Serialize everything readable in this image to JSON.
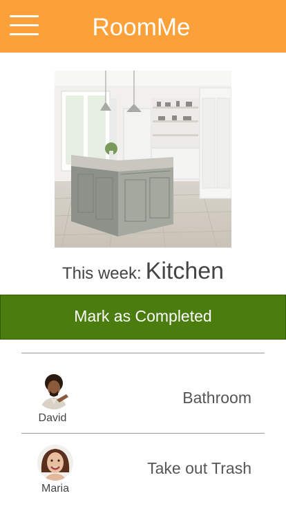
{
  "app": {
    "title": "RoomMe"
  },
  "header": {
    "menu_icon": "hamburger-menu-icon"
  },
  "current": {
    "prefix": "This week:",
    "room": "Kitchen",
    "image": "kitchen-photo"
  },
  "actions": {
    "complete_label": "Mark as Completed"
  },
  "roommates": [
    {
      "name": "David",
      "chore": "Bathroom",
      "avatar": "avatar-david"
    },
    {
      "name": "Maria",
      "chore": "Take out Trash",
      "avatar": "avatar-maria"
    }
  ],
  "colors": {
    "header": "#fca13a",
    "complete_button": "#4a7d0d",
    "text": "#444444"
  }
}
